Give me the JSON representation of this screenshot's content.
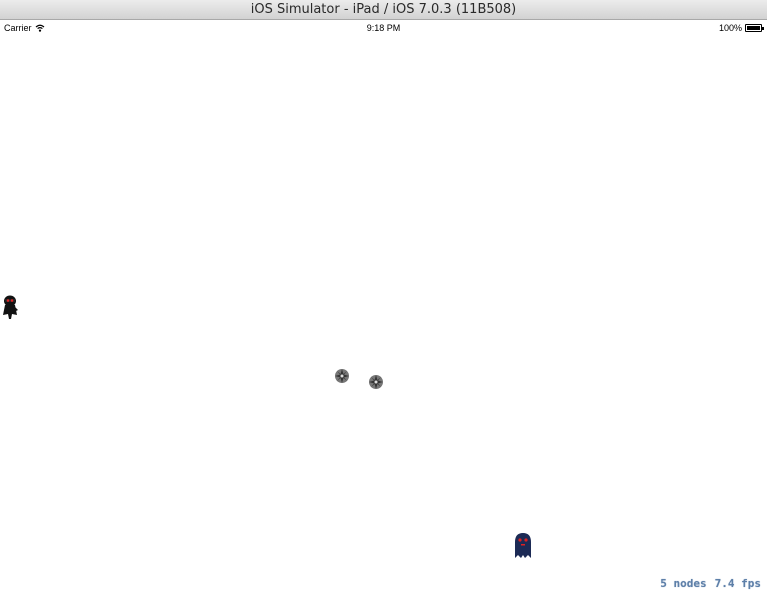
{
  "window": {
    "title": "iOS Simulator - iPad / iOS 7.0.3 (11B508)"
  },
  "status_bar": {
    "carrier": "Carrier",
    "wifi_icon": "wifi-icon",
    "time": "9:18 PM",
    "battery_percent": "100%",
    "battery_level": 1.0,
    "battery_icon": "battery-icon"
  },
  "scene": {
    "background_color": "#ffffff",
    "sprites": [
      {
        "name": "player",
        "icon": "ninja-icon",
        "color": "#111111"
      },
      {
        "name": "projectile",
        "icon": "shuriken-icon",
        "color": "#444444"
      },
      {
        "name": "projectile",
        "icon": "shuriken-icon",
        "color": "#444444"
      },
      {
        "name": "monster",
        "icon": "ghost-monster-icon",
        "color": "#1c2a55"
      }
    ],
    "debug": {
      "nodes": "5 nodes",
      "fps": "7.4 fps"
    }
  }
}
